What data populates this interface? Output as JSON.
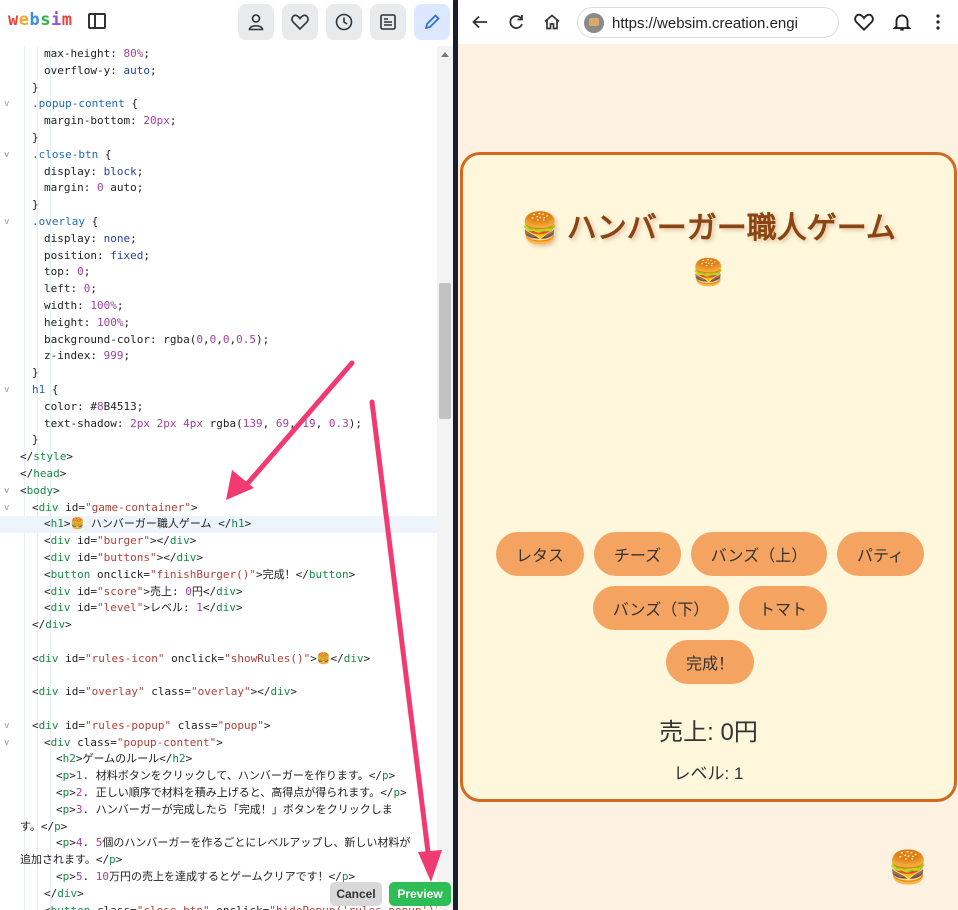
{
  "editor": {
    "logo_letters": [
      "w",
      "e",
      "b",
      "s",
      "i",
      "m"
    ],
    "cancel_label": "Cancel",
    "preview_label": "Preview",
    "code_lines": [
      {
        "fold": "",
        "indent": 2,
        "text": "max-height: 80%;"
      },
      {
        "fold": "",
        "indent": 2,
        "text": "overflow-y: auto;"
      },
      {
        "fold": "",
        "indent": 1,
        "text": "}"
      },
      {
        "fold": "v",
        "indent": 1,
        "text": ".popup-content {"
      },
      {
        "fold": "",
        "indent": 2,
        "text": "margin-bottom: 20px;"
      },
      {
        "fold": "",
        "indent": 1,
        "text": "}"
      },
      {
        "fold": "v",
        "indent": 1,
        "text": ".close-btn {"
      },
      {
        "fold": "",
        "indent": 2,
        "text": "display: block;"
      },
      {
        "fold": "",
        "indent": 2,
        "text": "margin: 0 auto;"
      },
      {
        "fold": "",
        "indent": 1,
        "text": "}"
      },
      {
        "fold": "v",
        "indent": 1,
        "text": ".overlay {"
      },
      {
        "fold": "",
        "indent": 2,
        "text": "display: none;"
      },
      {
        "fold": "",
        "indent": 2,
        "text": "position: fixed;"
      },
      {
        "fold": "",
        "indent": 2,
        "text": "top: 0;"
      },
      {
        "fold": "",
        "indent": 2,
        "text": "left: 0;"
      },
      {
        "fold": "",
        "indent": 2,
        "text": "width: 100%;"
      },
      {
        "fold": "",
        "indent": 2,
        "text": "height: 100%;"
      },
      {
        "fold": "",
        "indent": 2,
        "text": "background-color: rgba(0,0,0,0.5);"
      },
      {
        "fold": "",
        "indent": 2,
        "text": "z-index: 999;"
      },
      {
        "fold": "",
        "indent": 1,
        "text": "}"
      },
      {
        "fold": "v",
        "indent": 1,
        "text": "h1 {"
      },
      {
        "fold": "",
        "indent": 2,
        "text": "color: #8B4513;"
      },
      {
        "fold": "",
        "indent": 2,
        "text": "text-shadow: 2px 2px 4px rgba(139, 69, 19, 0.3);"
      },
      {
        "fold": "",
        "indent": 1,
        "text": "}"
      },
      {
        "fold": "",
        "indent": 0,
        "text": "</style>"
      },
      {
        "fold": "",
        "indent": 0,
        "text": "</head>"
      },
      {
        "fold": "v",
        "indent": 0,
        "text": "<body>"
      },
      {
        "fold": "v",
        "indent": 1,
        "text": "<div id=\"game-container\">"
      },
      {
        "fold": "",
        "indent": 2,
        "text": "<h1>🍔 ハンバーガー職人ゲーム </h1>",
        "highlight": true
      },
      {
        "fold": "",
        "indent": 2,
        "text": "<div id=\"burger\"></div>"
      },
      {
        "fold": "",
        "indent": 2,
        "text": "<div id=\"buttons\"></div>"
      },
      {
        "fold": "",
        "indent": 2,
        "text": "<button onclick=\"finishBurger()\">完成！</button>"
      },
      {
        "fold": "",
        "indent": 2,
        "text": "<div id=\"score\">売上: 0円</div>"
      },
      {
        "fold": "",
        "indent": 2,
        "text": "<div id=\"level\">レベル: 1</div>"
      },
      {
        "fold": "",
        "indent": 1,
        "text": "</div>"
      },
      {
        "fold": "",
        "indent": 0,
        "text": ""
      },
      {
        "fold": "",
        "indent": 1,
        "text": "<div id=\"rules-icon\" onclick=\"showRules()\">🍔</div>"
      },
      {
        "fold": "",
        "indent": 0,
        "text": ""
      },
      {
        "fold": "",
        "indent": 1,
        "text": "<div id=\"overlay\" class=\"overlay\"></div>"
      },
      {
        "fold": "",
        "indent": 0,
        "text": ""
      },
      {
        "fold": "v",
        "indent": 1,
        "text": "<div id=\"rules-popup\" class=\"popup\">"
      },
      {
        "fold": "v",
        "indent": 2,
        "text": "<div class=\"popup-content\">"
      },
      {
        "fold": "",
        "indent": 3,
        "text": "<h2>ゲームのルール</h2>"
      },
      {
        "fold": "",
        "indent": 3,
        "text": "<p>1. 材料ボタンをクリックして、ハンバーガーを作ります。</p>"
      },
      {
        "fold": "",
        "indent": 3,
        "text": "<p>2. 正しい順序で材料を積み上げると、高得点が得られます。</p>"
      },
      {
        "fold": "",
        "indent": 3,
        "text": "<p>3. ハンバーガーが完成したら「完成！」ボタンをクリックしま"
      },
      {
        "fold": "",
        "indent": 0,
        "text": "す。</p>"
      },
      {
        "fold": "",
        "indent": 3,
        "text": "<p>4. 5個のハンバーガーを作るごとにレベルアップし、新しい材料が"
      },
      {
        "fold": "",
        "indent": 0,
        "text": "追加されます。</p>"
      },
      {
        "fold": "",
        "indent": 3,
        "text": "<p>5. 10万円の売上を達成するとゲームクリアです！</p>"
      },
      {
        "fold": "",
        "indent": 2,
        "text": "</div>"
      },
      {
        "fold": "",
        "indent": 2,
        "text": "<button class=\"close-btn\" onclick=\"hidePopup('rules-popup')\">閉じ"
      }
    ]
  },
  "browser": {
    "url": "https://websim.creation.engi"
  },
  "game": {
    "title": "🍔 ハンバーガー職人ゲーム",
    "burger_emoji": "🍔",
    "ingredients": [
      "レタス",
      "チーズ",
      "バンズ（上）",
      "パティ",
      "バンズ（下）",
      "トマト"
    ],
    "finish_label": "完成！",
    "score": "売上: 0円",
    "level": "レベル: 1",
    "rules_icon": "🍔"
  },
  "colors": {
    "accent_border": "#d2691e",
    "title_color": "#8B4513",
    "button_bg": "#f4a460",
    "preview_green": "#2dbf55",
    "arrow_pink": "#f23a72"
  }
}
